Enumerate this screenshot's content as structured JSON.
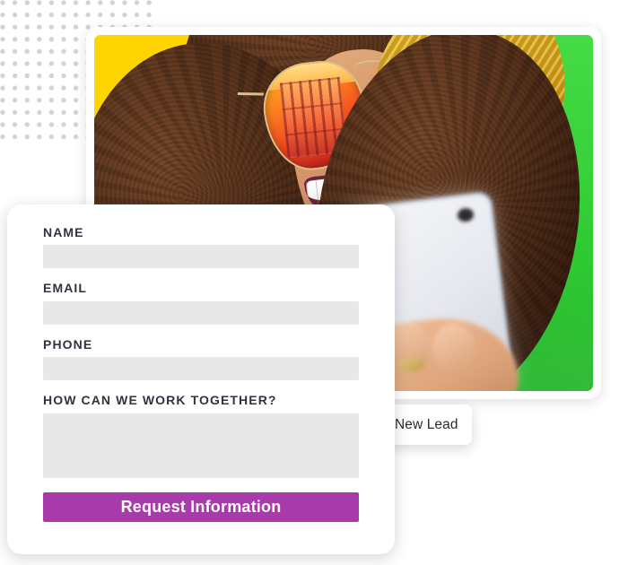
{
  "decor": {
    "dot_grid_name": "dot-grid-pattern",
    "dot_color": "#d3d3d3"
  },
  "photo_card": {
    "alt": "Smiling woman with curly hair wearing a yellow knit beanie and orange mirrored aviator sunglasses, taking a selfie with a white smartphone against a split yellow and green background",
    "bg_left_color": "#FFD400",
    "bg_right_color": "#35CC38",
    "hair_color": "#4e2c18",
    "beanie_color": "#E0B01C",
    "lens_color": "#F2491F",
    "phone_color": "#EAECF1"
  },
  "badge": {
    "label": "New Lead",
    "icon": "check-circle-icon",
    "icon_color": "#46C41E",
    "icon_check_color": "#ffffff",
    "background": "#ffffff"
  },
  "form": {
    "fields": [
      {
        "label": "NAME",
        "value": "",
        "placeholder": "",
        "type": "text",
        "name": "name"
      },
      {
        "label": "EMAIL",
        "value": "",
        "placeholder": "",
        "type": "text",
        "name": "email"
      },
      {
        "label": "PHONE",
        "value": "",
        "placeholder": "",
        "type": "text",
        "name": "phone"
      },
      {
        "label": "HOW CAN WE WORK TOGETHER?",
        "value": "",
        "placeholder": "",
        "type": "textarea",
        "name": "message"
      }
    ],
    "submit_label": "Request Information",
    "submit_color": "#A93AAC",
    "submit_text_color": "#ffffff",
    "label_color": "#2E3440",
    "input_background": "#E8E8E8"
  }
}
